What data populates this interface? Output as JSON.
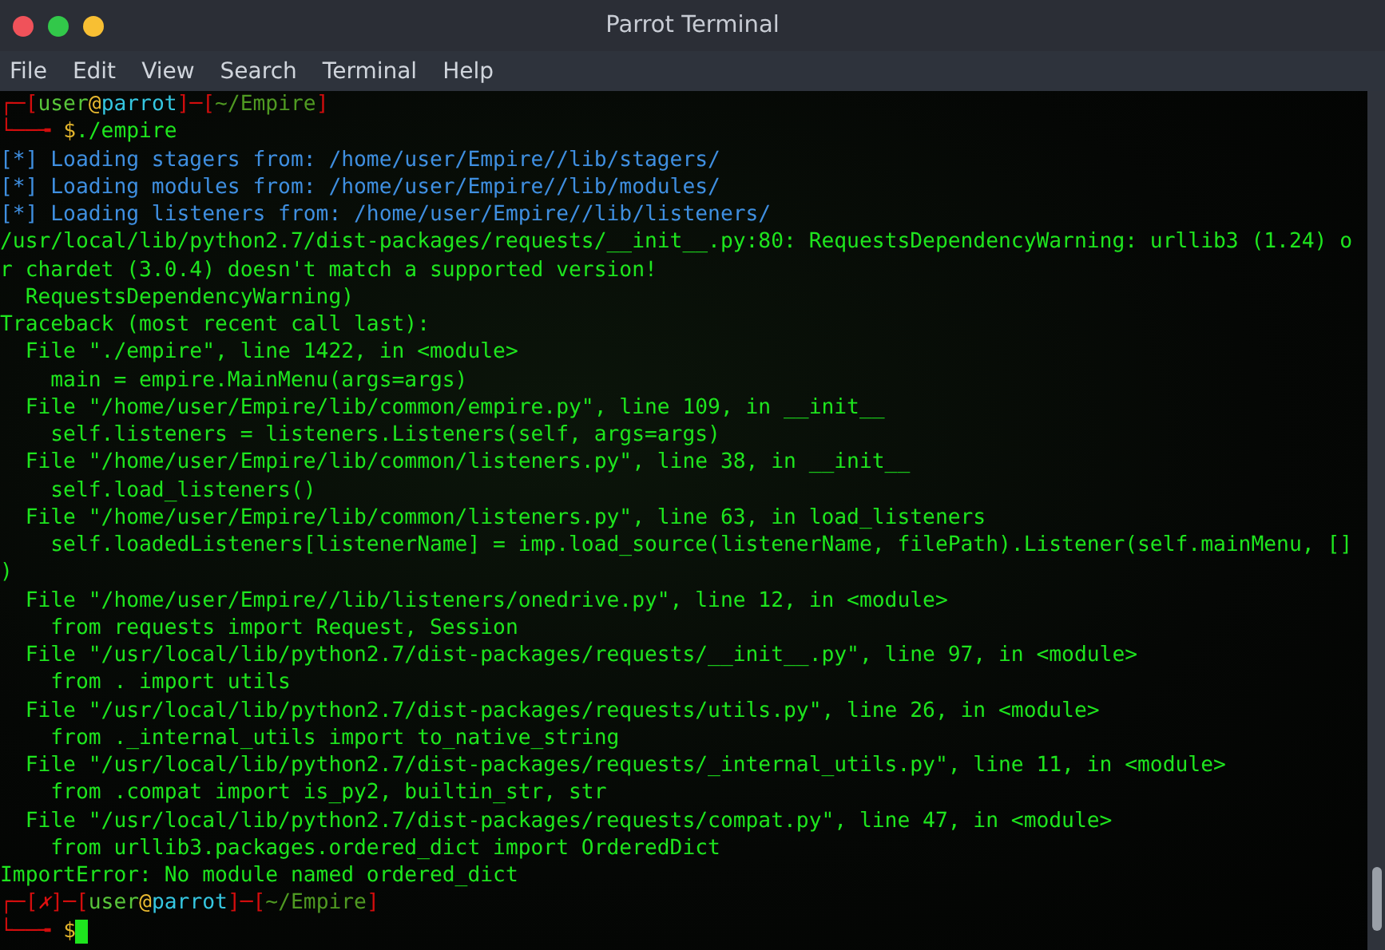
{
  "window": {
    "title": "Parrot Terminal"
  },
  "menu": [
    "File",
    "Edit",
    "View",
    "Search",
    "Terminal",
    "Help"
  ],
  "terminal": {
    "lines": [
      {
        "segments": [
          {
            "kind": "frame",
            "text": "┌─["
          },
          {
            "kind": "user",
            "text": "user"
          },
          {
            "kind": "at",
            "text": "@"
          },
          {
            "kind": "host",
            "text": "parrot"
          },
          {
            "kind": "frame",
            "text": "]─["
          },
          {
            "kind": "path",
            "text": "~/Empire"
          },
          {
            "kind": "frame",
            "text": "]"
          }
        ]
      },
      {
        "segments": [
          {
            "kind": "frame",
            "text": "└──╼ "
          },
          {
            "kind": "dollar",
            "text": "$"
          },
          {
            "kind": "output",
            "text": "./empire"
          }
        ]
      },
      {
        "segments": [
          {
            "kind": "info",
            "text": "[*] Loading stagers from: /home/user/Empire//lib/stagers/"
          }
        ]
      },
      {
        "segments": [
          {
            "kind": "info",
            "text": "[*] Loading modules from: /home/user/Empire//lib/modules/"
          }
        ]
      },
      {
        "segments": [
          {
            "kind": "info",
            "text": "[*] Loading listeners from: /home/user/Empire//lib/listeners/"
          }
        ]
      },
      {
        "segments": [
          {
            "kind": "output",
            "text": "/usr/local/lib/python2.7/dist-packages/requests/__init__.py:80: RequestsDependencyWarning: urllib3 (1.24) o"
          }
        ]
      },
      {
        "segments": [
          {
            "kind": "output",
            "text": "r chardet (3.0.4) doesn't match a supported version!"
          }
        ]
      },
      {
        "segments": [
          {
            "kind": "output",
            "text": "  RequestsDependencyWarning)"
          }
        ]
      },
      {
        "segments": [
          {
            "kind": "output",
            "text": "Traceback (most recent call last):"
          }
        ]
      },
      {
        "segments": [
          {
            "kind": "output",
            "text": "  File \"./empire\", line 1422, in <module>"
          }
        ]
      },
      {
        "segments": [
          {
            "kind": "output",
            "text": "    main = empire.MainMenu(args=args)"
          }
        ]
      },
      {
        "segments": [
          {
            "kind": "output",
            "text": "  File \"/home/user/Empire/lib/common/empire.py\", line 109, in __init__"
          }
        ]
      },
      {
        "segments": [
          {
            "kind": "output",
            "text": "    self.listeners = listeners.Listeners(self, args=args)"
          }
        ]
      },
      {
        "segments": [
          {
            "kind": "output",
            "text": "  File \"/home/user/Empire/lib/common/listeners.py\", line 38, in __init__"
          }
        ]
      },
      {
        "segments": [
          {
            "kind": "output",
            "text": "    self.load_listeners()"
          }
        ]
      },
      {
        "segments": [
          {
            "kind": "output",
            "text": "  File \"/home/user/Empire/lib/common/listeners.py\", line 63, in load_listeners"
          }
        ]
      },
      {
        "segments": [
          {
            "kind": "output",
            "text": "    self.loadedListeners[listenerName] = imp.load_source(listenerName, filePath).Listener(self.mainMenu, []"
          }
        ]
      },
      {
        "segments": [
          {
            "kind": "output",
            "text": ")"
          }
        ]
      },
      {
        "segments": [
          {
            "kind": "output",
            "text": "  File \"/home/user/Empire//lib/listeners/onedrive.py\", line 12, in <module>"
          }
        ]
      },
      {
        "segments": [
          {
            "kind": "output",
            "text": "    from requests import Request, Session"
          }
        ]
      },
      {
        "segments": [
          {
            "kind": "output",
            "text": "  File \"/usr/local/lib/python2.7/dist-packages/requests/__init__.py\", line 97, in <module>"
          }
        ]
      },
      {
        "segments": [
          {
            "kind": "output",
            "text": "    from . import utils"
          }
        ]
      },
      {
        "segments": [
          {
            "kind": "output",
            "text": "  File \"/usr/local/lib/python2.7/dist-packages/requests/utils.py\", line 26, in <module>"
          }
        ]
      },
      {
        "segments": [
          {
            "kind": "output",
            "text": "    from ._internal_utils import to_native_string"
          }
        ]
      },
      {
        "segments": [
          {
            "kind": "output",
            "text": "  File \"/usr/local/lib/python2.7/dist-packages/requests/_internal_utils.py\", line 11, in <module>"
          }
        ]
      },
      {
        "segments": [
          {
            "kind": "output",
            "text": "    from .compat import is_py2, builtin_str, str"
          }
        ]
      },
      {
        "segments": [
          {
            "kind": "output",
            "text": "  File \"/usr/local/lib/python2.7/dist-packages/requests/compat.py\", line 47, in <module>"
          }
        ]
      },
      {
        "segments": [
          {
            "kind": "output",
            "text": "    from urllib3.packages.ordered_dict import OrderedDict"
          }
        ]
      },
      {
        "segments": [
          {
            "kind": "output",
            "text": "ImportError: No module named ordered_dict"
          }
        ]
      },
      {
        "segments": [
          {
            "kind": "frame",
            "text": "┌─["
          },
          {
            "kind": "error",
            "text": "✗"
          },
          {
            "kind": "frame",
            "text": "]─["
          },
          {
            "kind": "user",
            "text": "user"
          },
          {
            "kind": "at",
            "text": "@"
          },
          {
            "kind": "host",
            "text": "parrot"
          },
          {
            "kind": "frame",
            "text": "]─["
          },
          {
            "kind": "path",
            "text": "~/Empire"
          },
          {
            "kind": "frame",
            "text": "]"
          }
        ]
      },
      {
        "segments": [
          {
            "kind": "frame",
            "text": "└──╼ "
          },
          {
            "kind": "dollar",
            "text": "$"
          }
        ],
        "cursor": true
      }
    ]
  }
}
